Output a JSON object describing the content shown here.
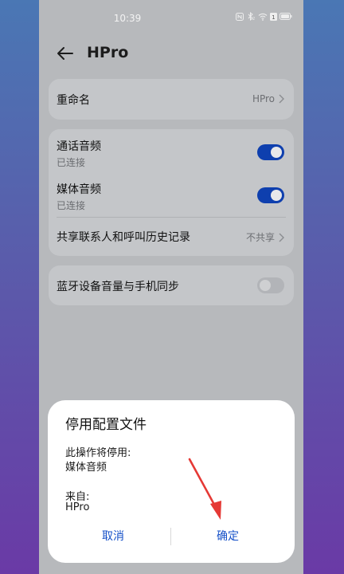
{
  "status_bar": {
    "time": "10:39",
    "battery_level": "1"
  },
  "header": {
    "title": "HPro"
  },
  "rename": {
    "label": "重命名",
    "value": "HPro"
  },
  "settings": [
    {
      "label": "通话音频",
      "status": "已连接",
      "enabled": true
    },
    {
      "label": "媒体音频",
      "status": "已连接",
      "enabled": true
    }
  ],
  "share": {
    "label": "共享联系人和呼叫历史记录",
    "value": "不共享"
  },
  "volume_sync": {
    "label": "蓝牙设备音量与手机同步",
    "enabled": false
  },
  "dialog": {
    "title": "停用配置文件",
    "line1": "此操作将停用:",
    "line2": "媒体音频",
    "line3": "来自:",
    "line4": "HPro",
    "cancel": "取消",
    "confirm": "确定"
  },
  "colors": {
    "accent": "#1550c8",
    "toggle_on": "#0e3fae",
    "arrow": "#e53935"
  }
}
